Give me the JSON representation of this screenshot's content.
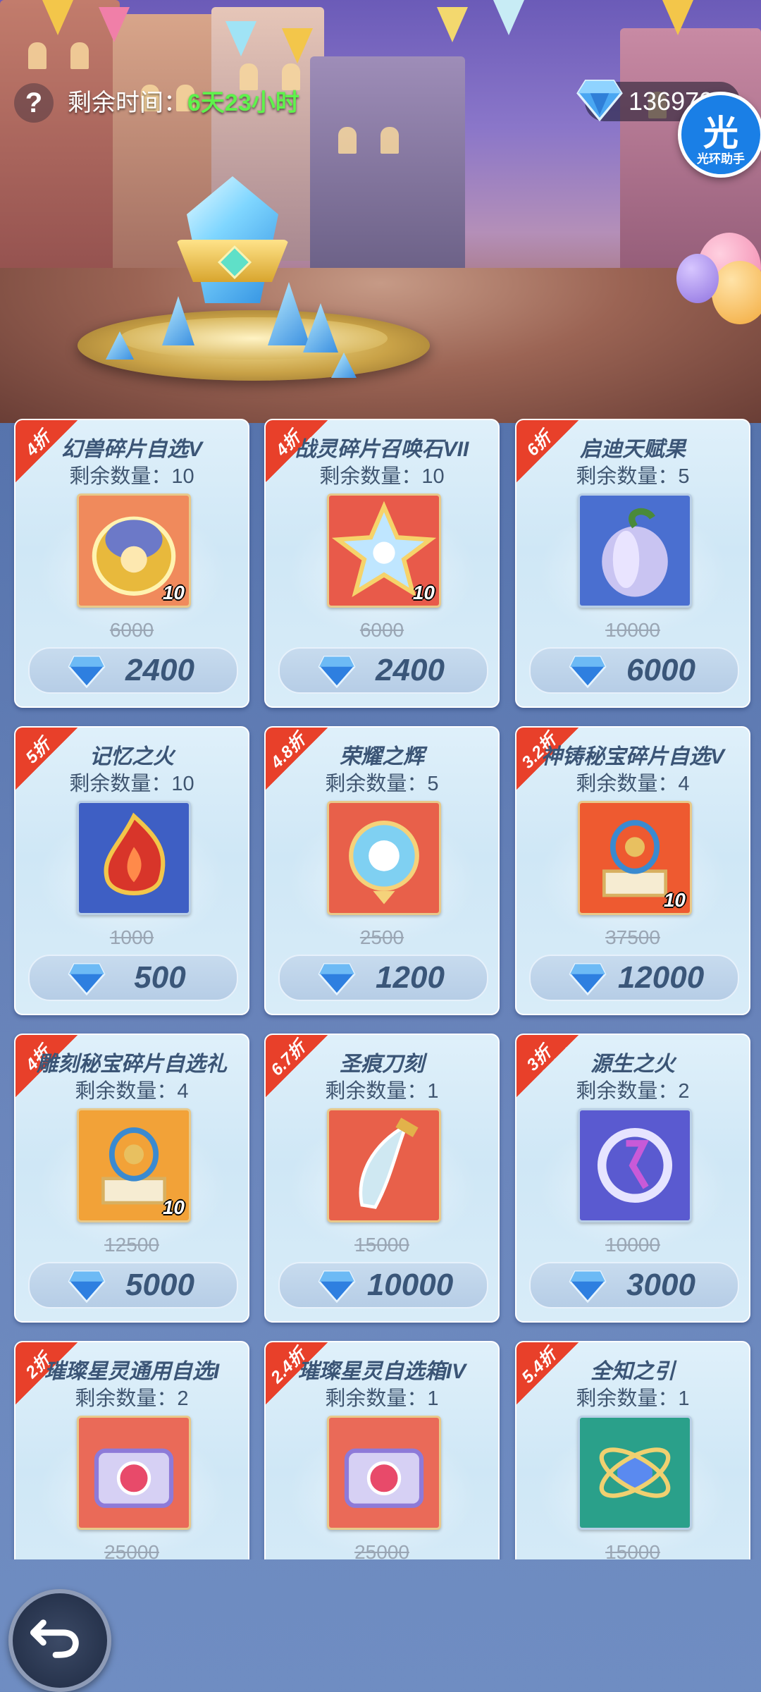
{
  "header": {
    "help_label": "?",
    "time_label": "剩余时间：",
    "time_value": "6天23小时",
    "currency_value": "136970",
    "assistant_char": "光",
    "assistant_label": "光环助手"
  },
  "items": [
    {
      "discount": "4折",
      "name": "幻兽碎片自选V",
      "stock": "剩余数量：10",
      "count": "10",
      "old_price": "6000",
      "price": "2400",
      "icon": "golden-helmet-chest-icon"
    },
    {
      "discount": "4折",
      "name": "战灵碎片召唤石VII",
      "stock": "剩余数量：10",
      "count": "10",
      "old_price": "6000",
      "price": "2400",
      "icon": "star-summon-stone-icon"
    },
    {
      "discount": "6折",
      "name": "启迪天赋果",
      "stock": "剩余数量：5",
      "count": "",
      "old_price": "10000",
      "price": "6000",
      "icon": "pepper-fruit-icon"
    },
    {
      "discount": "5折",
      "name": "记忆之火",
      "stock": "剩余数量：10",
      "count": "",
      "old_price": "1000",
      "price": "500",
      "icon": "flame-crest-icon"
    },
    {
      "discount": "4.8折",
      "name": "荣耀之辉",
      "stock": "剩余数量：5",
      "count": "",
      "old_price": "2500",
      "price": "1200",
      "icon": "glowing-orb-icon"
    },
    {
      "discount": "3.2折",
      "name": "神铸秘宝碎片自选V",
      "stock": "剩余数量：4",
      "count": "10",
      "old_price": "37500",
      "price": "12000",
      "icon": "gyro-altar-icon"
    },
    {
      "discount": "4折",
      "name": "雕刻秘宝碎片自选礼",
      "stock": "剩余数量：4",
      "count": "10",
      "old_price": "12500",
      "price": "5000",
      "icon": "gyro-altar-icon"
    },
    {
      "discount": "6.7折",
      "name": "圣痕刀刻",
      "stock": "剩余数量：1",
      "count": "",
      "old_price": "15000",
      "price": "10000",
      "icon": "blade-icon"
    },
    {
      "discount": "3折",
      "name": "源生之火",
      "stock": "剩余数量：2",
      "count": "",
      "old_price": "10000",
      "price": "3000",
      "icon": "rune-ring-icon"
    },
    {
      "discount": "2折",
      "name": "璀璨星灵通用自选I",
      "stock": "剩余数量：2",
      "count": "",
      "old_price": "25000",
      "price": "",
      "icon": "star-chest-icon"
    },
    {
      "discount": "2.4折",
      "name": "璀璨星灵自选箱IV",
      "stock": "剩余数量：1",
      "count": "",
      "old_price": "25000",
      "price": "",
      "icon": "star-chest-icon"
    },
    {
      "discount": "5.4折",
      "name": "全知之引",
      "stock": "剩余数量：1",
      "count": "",
      "old_price": "15000",
      "price": "",
      "icon": "armillary-orb-icon"
    }
  ],
  "colors": {
    "ribbon": "#e8402a",
    "time_value": "#5ff24c",
    "card_text": "#3b5576",
    "gem": "#2e7fe0"
  }
}
